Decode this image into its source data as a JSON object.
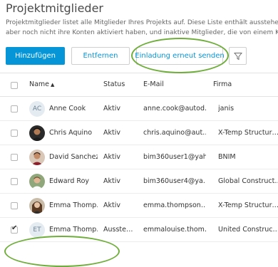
{
  "page": {
    "title": "Projektmitglieder",
    "description_line1": "Projektmitglieder listet alle Mitglieder Ihres Projekts auf. Diese Liste enthält ausstehende",
    "description_line2": "aber noch nicht ihre Konten aktiviert haben, und inaktive Mitglieder, die von einem Konto"
  },
  "toolbar": {
    "add_label": "Hinzufügen",
    "remove_label": "Entfernen",
    "resend_label": "Einladung erneut senden",
    "filter_icon": "filter-icon"
  },
  "table": {
    "columns": [
      "Name",
      "Status",
      "E-Mail",
      "Firma"
    ],
    "sort_indicator": "▲",
    "rows": [
      {
        "initials": "AC",
        "name": "Anne Cook",
        "status": "Aktiv",
        "email": "anne.cook@autod…",
        "company": "janis",
        "checked": false
      },
      {
        "initials": "",
        "name": "Chris Aquino",
        "status": "Aktiv",
        "email": "chris.aquino@aut…",
        "company": "X-Temp Structur…",
        "checked": false
      },
      {
        "initials": "",
        "name": "David Sanchez",
        "status": "Aktiv",
        "email": "bim360user1@yah…",
        "company": "BNIM",
        "checked": false
      },
      {
        "initials": "",
        "name": "Edward Roy",
        "status": "Aktiv",
        "email": "bim360user4@ya…",
        "company": "Global Construct…",
        "checked": false
      },
      {
        "initials": "",
        "name": "Emma Thomp…",
        "status": "Aktiv",
        "email": "emma.thompson…",
        "company": "X-Temp Structur…",
        "checked": false
      },
      {
        "initials": "ET",
        "name": "Emma Thomp…",
        "status": "Ausste…",
        "email": "emmalouise.thom…",
        "company": "United Construc…",
        "checked": true
      }
    ]
  },
  "colors": {
    "accent": "#0696d7",
    "highlight": "#6fae3b"
  }
}
